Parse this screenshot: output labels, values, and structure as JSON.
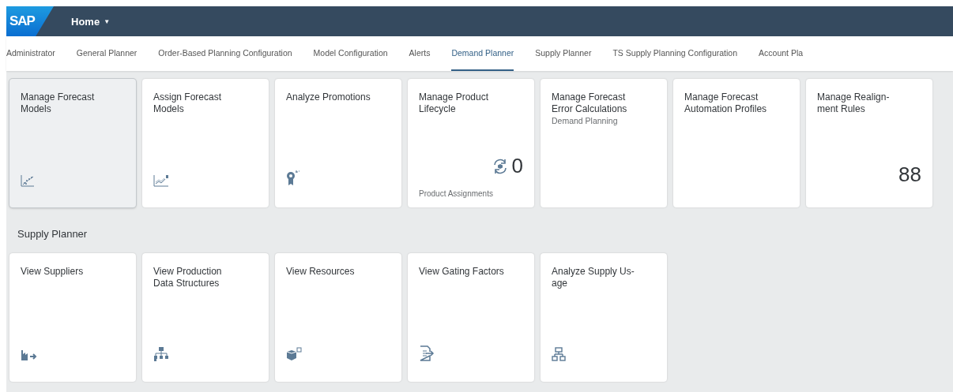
{
  "shell": {
    "logo": "SAP",
    "title": "Home",
    "menu_caret": "▼"
  },
  "tabs": [
    {
      "label": "Administrator",
      "selected": false
    },
    {
      "label": "General Planner",
      "selected": false
    },
    {
      "label": "Order-Based Planning Configuration",
      "selected": false
    },
    {
      "label": "Model Configuration",
      "selected": false
    },
    {
      "label": "Alerts",
      "selected": false
    },
    {
      "label": "Demand Planner",
      "selected": true
    },
    {
      "label": "Supply Planner",
      "selected": false
    },
    {
      "label": "TS Supply Planning Configuration",
      "selected": false
    },
    {
      "label": "Account Pla",
      "selected": false
    }
  ],
  "groups": [
    {
      "tiles": [
        {
          "title": "Manage Forecast Models",
          "highlighted": true
        },
        {
          "title": "Assign Forecast Models",
          "highlighted": false
        },
        {
          "title": "Analyze Promotions",
          "highlighted": false
        },
        {
          "title": "Manage Product Lifecycle",
          "number": "0",
          "footer": "Product Assignments",
          "highlighted": false
        },
        {
          "title": "Manage Forecast Error Calculations",
          "subtitle": "Demand Planning",
          "highlighted": false
        },
        {
          "title": "Manage Forecast Automation Profiles",
          "highlighted": false
        },
        {
          "title": "Manage Realign-ment Rules",
          "number": "88",
          "highlighted": false
        }
      ]
    },
    {
      "title": "Supply Planner",
      "tiles": [
        {
          "title": "View Suppliers",
          "highlighted": false
        },
        {
          "title": "View Production Data Structures",
          "highlighted": false
        },
        {
          "title": "View Resources",
          "highlighted": false
        },
        {
          "title": "View Gating Factors",
          "highlighted": false
        },
        {
          "title": "Analyze Supply Us-age",
          "highlighted": false
        }
      ]
    }
  ]
}
